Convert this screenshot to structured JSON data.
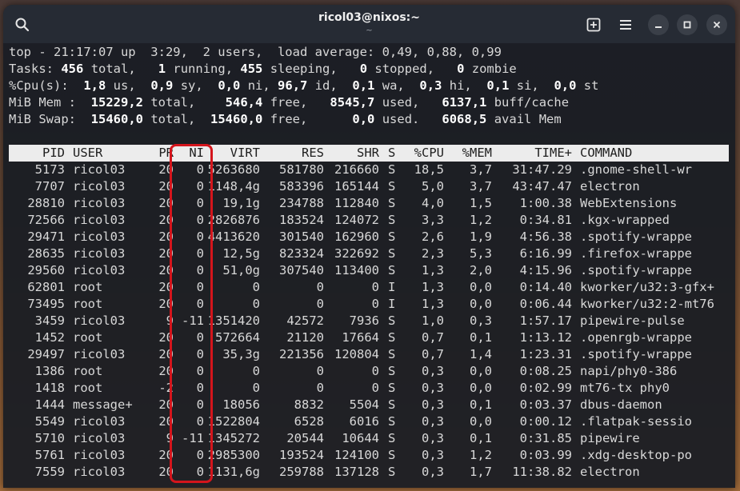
{
  "window": {
    "title": "ricol03@nixos:~",
    "subtitle": "~",
    "icons": [
      "search-icon",
      "new-tab-icon",
      "menu-icon",
      "minimize-icon",
      "maximize-icon",
      "close-icon"
    ],
    "glyphs": {
      "search": "⚲",
      "new_tab": "⊞",
      "menu": "☰",
      "minimize": "–",
      "maximize": "□",
      "close": "✕"
    }
  },
  "summary": {
    "top_line": "top - 21:17:07 up  3:29,  2 users,  load average: 0,49, 0,88, 0,99",
    "tasks": {
      "label": "Tasks:",
      "total": "456",
      "total_label": "total,",
      "running": "1",
      "running_label": "running,",
      "sleeping": "455",
      "sleeping_label": "sleeping,",
      "stopped": "0",
      "stopped_label": "stopped,",
      "zombie": "0",
      "zombie_label": "zombie"
    },
    "cpu": {
      "label": "%Cpu(s):",
      "us": "1,8",
      "us_label": "us,",
      "sy": "0,9",
      "sy_label": "sy,",
      "ni": "0,0",
      "ni_label": "ni,",
      "id": "96,7",
      "id_label": "id,",
      "wa": "0,1",
      "wa_label": "wa,",
      "hi": "0,3",
      "hi_label": "hi,",
      "si": "0,1",
      "si_label": "si,",
      "st": "0,0",
      "st_label": "st"
    },
    "mem": {
      "label": "MiB Mem :",
      "total": "15229,2",
      "total_label": "total,",
      "free": "546,4",
      "free_label": "free,",
      "used": "8545,7",
      "used_label": "used,",
      "buff": "6137,1",
      "buff_label": "buff/cache"
    },
    "swap": {
      "label": "MiB Swap:",
      "total": "15460,0",
      "total_label": "total,",
      "free": "15460,0",
      "free_label": "free,",
      "used": "0,0",
      "used_label": "used.",
      "avail": "6068,5",
      "avail_label": "avail Mem"
    }
  },
  "table": {
    "headers": {
      "pid": "PID",
      "user": "USER",
      "pr": "PR",
      "ni": "NI",
      "virt": "VIRT",
      "res": "RES",
      "shr": "SHR",
      "s": "S",
      "cpu": "%CPU",
      "mem": "%MEM",
      "time": "TIME+",
      "command": "COMMAND"
    },
    "rows": [
      {
        "pid": "5173",
        "user": "ricol03",
        "pr": "20",
        "ni": "0",
        "virt": "5263680",
        "res": "581780",
        "shr": "216660",
        "s": "S",
        "cpu": "18,5",
        "mem": "3,7",
        "time": "31:47.29",
        "command": ".gnome-shell-wr"
      },
      {
        "pid": "7707",
        "user": "ricol03",
        "pr": "20",
        "ni": "0",
        "virt": "1148,4g",
        "res": "583396",
        "shr": "165144",
        "s": "S",
        "cpu": "5,0",
        "mem": "3,7",
        "time": "43:47.47",
        "command": "electron"
      },
      {
        "pid": "28810",
        "user": "ricol03",
        "pr": "20",
        "ni": "0",
        "virt": "19,1g",
        "res": "234788",
        "shr": "112840",
        "s": "S",
        "cpu": "4,0",
        "mem": "1,5",
        "time": "1:00.38",
        "command": "WebExtensions"
      },
      {
        "pid": "72566",
        "user": "ricol03",
        "pr": "20",
        "ni": "0",
        "virt": "2826876",
        "res": "183524",
        "shr": "124072",
        "s": "S",
        "cpu": "3,3",
        "mem": "1,2",
        "time": "0:34.81",
        "command": ".kgx-wrapped"
      },
      {
        "pid": "29471",
        "user": "ricol03",
        "pr": "20",
        "ni": "0",
        "virt": "4413620",
        "res": "301540",
        "shr": "162960",
        "s": "S",
        "cpu": "2,6",
        "mem": "1,9",
        "time": "4:56.38",
        "command": ".spotify-wrappe"
      },
      {
        "pid": "28635",
        "user": "ricol03",
        "pr": "20",
        "ni": "0",
        "virt": "12,5g",
        "res": "823324",
        "shr": "322692",
        "s": "S",
        "cpu": "2,3",
        "mem": "5,3",
        "time": "6:16.99",
        "command": ".firefox-wrappe"
      },
      {
        "pid": "29560",
        "user": "ricol03",
        "pr": "20",
        "ni": "0",
        "virt": "51,0g",
        "res": "307540",
        "shr": "113400",
        "s": "S",
        "cpu": "1,3",
        "mem": "2,0",
        "time": "4:15.96",
        "command": ".spotify-wrappe"
      },
      {
        "pid": "62801",
        "user": "root",
        "pr": "20",
        "ni": "0",
        "virt": "0",
        "res": "0",
        "shr": "0",
        "s": "I",
        "cpu": "1,3",
        "mem": "0,0",
        "time": "0:14.40",
        "command": "kworker/u32:3-gfx+"
      },
      {
        "pid": "73495",
        "user": "root",
        "pr": "20",
        "ni": "0",
        "virt": "0",
        "res": "0",
        "shr": "0",
        "s": "I",
        "cpu": "1,3",
        "mem": "0,0",
        "time": "0:06.44",
        "command": "kworker/u32:2-mt76"
      },
      {
        "pid": "3459",
        "user": "ricol03",
        "pr": "9",
        "ni": "-11",
        "virt": "1351420",
        "res": "42572",
        "shr": "7936",
        "s": "S",
        "cpu": "1,0",
        "mem": "0,3",
        "time": "1:57.17",
        "command": "pipewire-pulse"
      },
      {
        "pid": "1452",
        "user": "root",
        "pr": "20",
        "ni": "0",
        "virt": "572664",
        "res": "21120",
        "shr": "17664",
        "s": "S",
        "cpu": "0,7",
        "mem": "0,1",
        "time": "1:13.12",
        "command": ".openrgb-wrappe"
      },
      {
        "pid": "29497",
        "user": "ricol03",
        "pr": "20",
        "ni": "0",
        "virt": "35,3g",
        "res": "221356",
        "shr": "120804",
        "s": "S",
        "cpu": "0,7",
        "mem": "1,4",
        "time": "1:23.31",
        "command": ".spotify-wrappe"
      },
      {
        "pid": "1386",
        "user": "root",
        "pr": "20",
        "ni": "0",
        "virt": "0",
        "res": "0",
        "shr": "0",
        "s": "S",
        "cpu": "0,3",
        "mem": "0,0",
        "time": "0:08.25",
        "command": "napi/phy0-386"
      },
      {
        "pid": "1418",
        "user": "root",
        "pr": "-2",
        "ni": "0",
        "virt": "0",
        "res": "0",
        "shr": "0",
        "s": "S",
        "cpu": "0,3",
        "mem": "0,0",
        "time": "0:02.99",
        "command": "mt76-tx phy0"
      },
      {
        "pid": "1444",
        "user": "message+",
        "pr": "20",
        "ni": "0",
        "virt": "18056",
        "res": "8832",
        "shr": "5504",
        "s": "S",
        "cpu": "0,3",
        "mem": "0,1",
        "time": "0:03.37",
        "command": "dbus-daemon"
      },
      {
        "pid": "5549",
        "user": "ricol03",
        "pr": "20",
        "ni": "0",
        "virt": "1522804",
        "res": "6528",
        "shr": "6016",
        "s": "S",
        "cpu": "0,3",
        "mem": "0,0",
        "time": "0:00.12",
        "command": ".flatpak-sessio"
      },
      {
        "pid": "5710",
        "user": "ricol03",
        "pr": "9",
        "ni": "-11",
        "virt": "1345272",
        "res": "20544",
        "shr": "10644",
        "s": "S",
        "cpu": "0,3",
        "mem": "0,1",
        "time": "0:31.85",
        "command": "pipewire"
      },
      {
        "pid": "5761",
        "user": "ricol03",
        "pr": "20",
        "ni": "0",
        "virt": "2985300",
        "res": "193524",
        "shr": "124100",
        "s": "S",
        "cpu": "0,3",
        "mem": "1,2",
        "time": "0:03.99",
        "command": ".xdg-desktop-po"
      },
      {
        "pid": "7559",
        "user": "ricol03",
        "pr": "20",
        "ni": "0",
        "virt": "1131,6g",
        "res": "259788",
        "shr": "137128",
        "s": "S",
        "cpu": "0,3",
        "mem": "1,7",
        "time": "11:38.82",
        "command": "electron"
      }
    ]
  },
  "colors": {
    "terminal_bg": "#181c24",
    "header_bar_bg": "#262b34",
    "table_header_bg": "#ececec",
    "highlight": "#d4151c"
  }
}
